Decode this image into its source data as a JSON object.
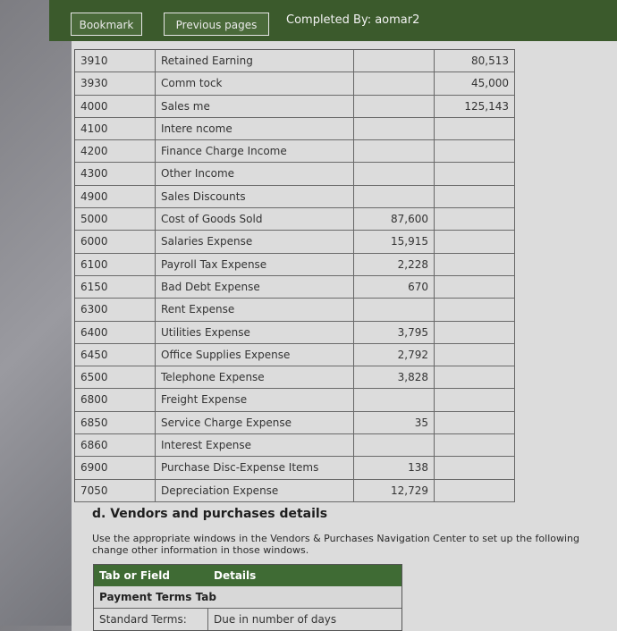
{
  "toolbar": {
    "bookmark_label": "Bookmark",
    "previous_label": "Previous pages",
    "completed_text": "Completed By: aomar2"
  },
  "ledger": {
    "rows": [
      {
        "num": "3910",
        "name": "Retained Earning",
        "debit": "",
        "credit": "80,513"
      },
      {
        "num": "3930",
        "name": "Comm    tock",
        "debit": "",
        "credit": "45,000"
      },
      {
        "num": "4000",
        "name": "Sales    me",
        "debit": "",
        "credit": "125,143"
      },
      {
        "num": "4100",
        "name": "Intere   ncome",
        "debit": "",
        "credit": ""
      },
      {
        "num": "4200",
        "name": "Finance Charge Income",
        "debit": "",
        "credit": ""
      },
      {
        "num": "4300",
        "name": "Other Income",
        "debit": "",
        "credit": ""
      },
      {
        "num": "4900",
        "name": "Sales Discounts",
        "debit": "",
        "credit": ""
      },
      {
        "num": "5000",
        "name": "Cost of Goods Sold",
        "debit": "87,600",
        "credit": ""
      },
      {
        "num": "6000",
        "name": "Salaries Expense",
        "debit": "15,915",
        "credit": ""
      },
      {
        "num": "6100",
        "name": "Payroll Tax Expense",
        "debit": "2,228",
        "credit": ""
      },
      {
        "num": "6150",
        "name": "Bad Debt Expense",
        "debit": "670",
        "credit": ""
      },
      {
        "num": "6300",
        "name": "Rent Expense",
        "debit": "",
        "credit": ""
      },
      {
        "num": "6400",
        "name": "Utilities Expense",
        "debit": "3,795",
        "credit": ""
      },
      {
        "num": "6450",
        "name": "Office Supplies Expense",
        "debit": "2,792",
        "credit": ""
      },
      {
        "num": "6500",
        "name": "Telephone Expense",
        "debit": "3,828",
        "credit": ""
      },
      {
        "num": "6800",
        "name": "Freight Expense",
        "debit": "",
        "credit": ""
      },
      {
        "num": "6850",
        "name": "Service Charge Expense",
        "debit": "35",
        "credit": ""
      },
      {
        "num": "6860",
        "name": "Interest Expense",
        "debit": "",
        "credit": ""
      },
      {
        "num": "6900",
        "name": "Purchase Disc-Expense Items",
        "debit": "138",
        "credit": ""
      },
      {
        "num": "7050",
        "name": "Depreciation Expense",
        "debit": "12,729",
        "credit": ""
      }
    ]
  },
  "section": {
    "title": "d. Vendors and purchases details",
    "instructions": "Use the appropriate windows in the Vendors & Purchases Navigation Center to set up the following change other information in those windows."
  },
  "details_table": {
    "header_left": "Tab or Field",
    "header_right": "Details",
    "subheader": "Payment Terms Tab",
    "row_left": "Standard Terms:",
    "row_right": "Due in number of days"
  }
}
